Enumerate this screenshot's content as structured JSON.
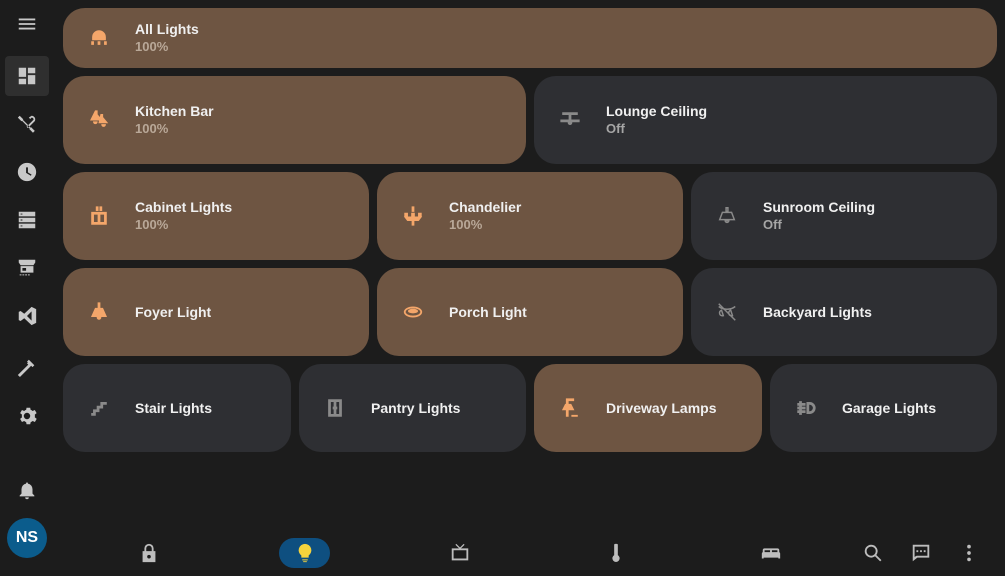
{
  "sidebar": {
    "items": [
      {
        "icon": "menu-icon"
      },
      {
        "icon": "dashboard-icon"
      },
      {
        "icon": "tools-icon"
      },
      {
        "icon": "history-icon"
      },
      {
        "icon": "server-icon"
      },
      {
        "icon": "hacs-store-icon"
      },
      {
        "icon": "vscode-icon"
      },
      {
        "icon": "hammer-icon"
      },
      {
        "icon": "settings-icon"
      },
      {
        "icon": "bell-icon"
      }
    ],
    "avatar_initials": "NS"
  },
  "cards": [
    {
      "name": "All Lights",
      "state": "100%",
      "on": true,
      "icon": "ceiling-lights-icon"
    },
    {
      "name": "Kitchen Bar",
      "state": "100%",
      "on": true,
      "icon": "pendant-lights-icon"
    },
    {
      "name": "Lounge Ceiling",
      "state": "Off",
      "on": false,
      "icon": "ceiling-fan-light-icon"
    },
    {
      "name": "Cabinet Lights",
      "state": "100%",
      "on": true,
      "icon": "cabinet-light-icon"
    },
    {
      "name": "Chandelier",
      "state": "100%",
      "on": true,
      "icon": "chandelier-icon"
    },
    {
      "name": "Sunroom Ceiling",
      "state": "Off",
      "on": false,
      "icon": "ceiling-light-icon"
    },
    {
      "name": "Foyer Light",
      "state": "",
      "on": true,
      "icon": "pendant-light-icon"
    },
    {
      "name": "Porch Light",
      "state": "",
      "on": true,
      "icon": "flush-light-icon"
    },
    {
      "name": "Backyard Lights",
      "state": "",
      "on": false,
      "icon": "string-lights-off-icon"
    },
    {
      "name": "Stair Lights",
      "state": "",
      "on": false,
      "icon": "stairs-icon"
    },
    {
      "name": "Pantry Lights",
      "state": "",
      "on": false,
      "icon": "wardrobe-icon"
    },
    {
      "name": "Driveway Lamps",
      "state": "",
      "on": true,
      "icon": "outdoor-lamp-icon"
    },
    {
      "name": "Garage Lights",
      "state": "",
      "on": false,
      "icon": "parking-light-icon"
    }
  ],
  "bottom_nav": [
    {
      "icon": "lock-icon"
    },
    {
      "icon": "lightbulb-icon",
      "active": true
    },
    {
      "icon": "tv-icon"
    },
    {
      "icon": "thermometer-icon"
    },
    {
      "icon": "sofa-icon"
    },
    {
      "icon": "search-icon"
    },
    {
      "icon": "assist-chat-icon"
    },
    {
      "icon": "more-vertical-icon"
    }
  ]
}
